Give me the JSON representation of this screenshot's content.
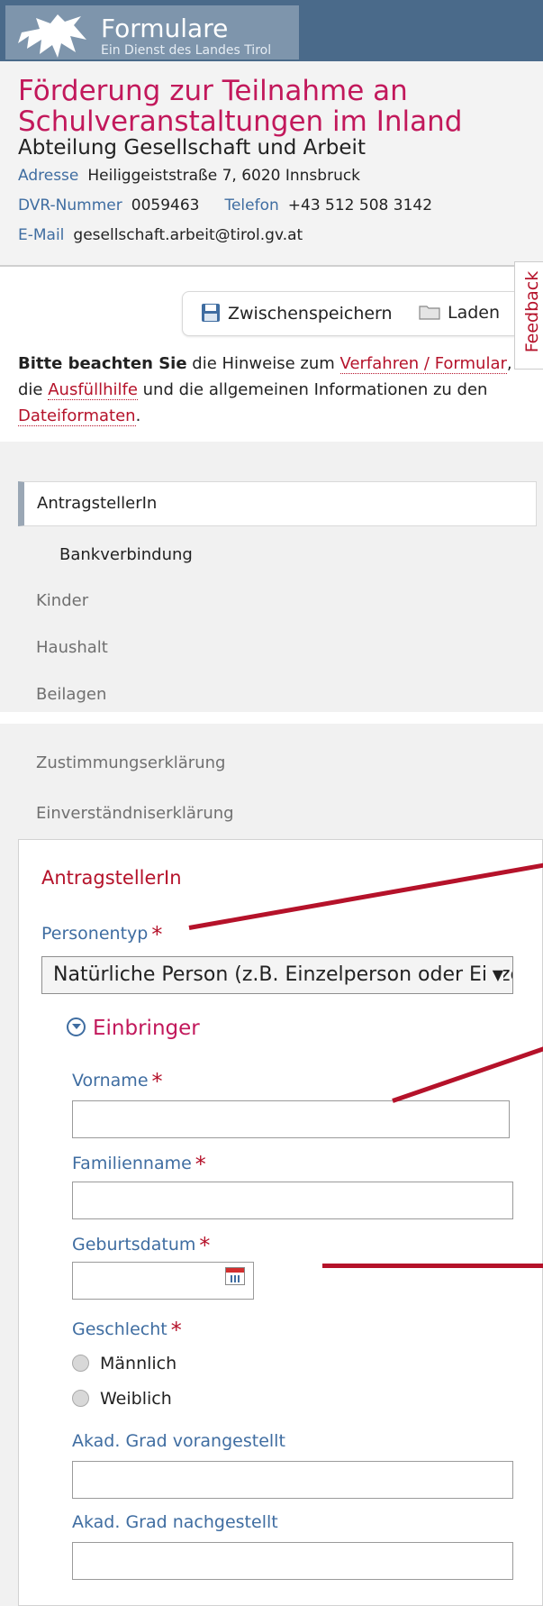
{
  "brand": {
    "title": "Formulare",
    "subtitle": "Ein Dienst des Landes Tirol"
  },
  "header": {
    "title": "Förderung zur Teilnahme an Schulveranstaltungen im Inland",
    "subtitle": "Abteilung Gesellschaft und Arbeit",
    "address_label": "Adresse",
    "address_value": "Heiliggeiststraße 7, 6020 Innsbruck",
    "dvr_label": "DVR-Nummer",
    "dvr_value": "0059463",
    "phone_label": "Telefon",
    "phone_value": "+43 512 508 3142",
    "email_label": "E-Mail",
    "email_value": "gesellschaft.arbeit@tirol.gv.at"
  },
  "toolbar": {
    "save_label": "Zwischenspeichern",
    "load_label": "Laden"
  },
  "feedback_label": "Feedback",
  "notice": {
    "bold": "Bitte beachten Sie",
    "text1": " die Hinweise zum ",
    "link1": "Verfahren / Formular",
    "text2": ", die ",
    "link2": "Ausfüllhilfe",
    "text3": " und die allgemeinen Informationen zu den ",
    "link3": "Dateiformaten",
    "text4": "."
  },
  "nav": {
    "items": [
      {
        "label": "AntragstellerIn"
      },
      {
        "label": "Bankverbindung"
      },
      {
        "label": "Kinder"
      },
      {
        "label": "Haushalt"
      },
      {
        "label": "Beilagen"
      },
      {
        "label": "Zustimmungserklärung"
      },
      {
        "label": "Einverständniserklärung"
      }
    ]
  },
  "form": {
    "section_title": "AntragstellerIn",
    "personentyp_label": "Personentyp",
    "personentyp_value": "Natürliche Person (z.B. Einzelperson oder Einzelunternehmen)",
    "required_mark": "*",
    "einbringer_label": "Einbringer",
    "vorname_label": "Vorname",
    "familienname_label": "Familienname",
    "geburtsdatum_label": "Geburtsdatum",
    "geschlecht_label": "Geschlecht",
    "gender_male": "Männlich",
    "gender_female": "Weiblich",
    "akad_vor_label": "Akad. Grad vorangestellt",
    "akad_nach_label": "Akad. Grad nachgestellt"
  },
  "colors": {
    "brand_bar": "#4a6a8a",
    "accent_red": "#b5122a",
    "title_magenta": "#c2185b",
    "label_blue": "#3f6da1"
  }
}
